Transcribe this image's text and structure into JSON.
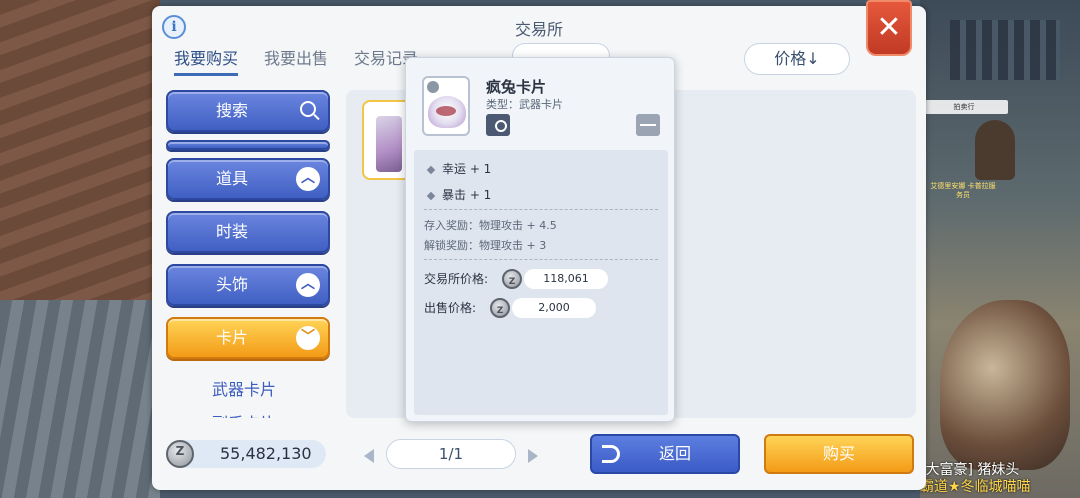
{
  "window": {
    "title": "交易所"
  },
  "tabs": [
    {
      "label": "我要购买"
    },
    {
      "label": "我要出售"
    },
    {
      "label": "交易记录"
    }
  ],
  "sort": {
    "label": "价格↓"
  },
  "menu": {
    "search": "搜索",
    "items": "道具",
    "fashion": "时装",
    "headwear": "头饰",
    "cards": "卡片",
    "sub_weapon_cards": "武器卡片",
    "sub_next": "副手卡片"
  },
  "bottom": {
    "balance": "55,482,130",
    "page": "1/1",
    "back": "返回",
    "buy": "购买"
  },
  "tooltip": {
    "name": "疯兔卡片",
    "type": "类型：武器卡片",
    "stats": [
      "幸运 + 1",
      "暴击 + 1"
    ],
    "deposit_bonus": "存入奖励：物理攻击 + 4.5",
    "unlock_bonus": "解锁奖励：物理攻击 + 3",
    "market_price_label": "交易所价格:",
    "market_price": "118,061",
    "sell_price_label": "出售价格:",
    "sell_price": "2,000"
  },
  "scene": {
    "stall_label": "拍卖行",
    "npc_name": "艾德里安娜\n卡普拉服务员",
    "guild_tag": "[大富豪] 猪妹头",
    "guild_name": "霸道★冬临城喵喵"
  },
  "colors": {
    "accent_blue": "#4160c3",
    "accent_orange": "#f39b17",
    "close_red": "#d4472e"
  }
}
